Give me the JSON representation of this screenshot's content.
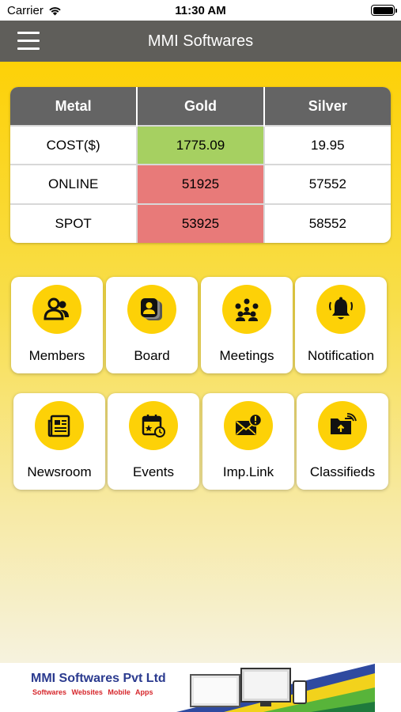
{
  "status_bar": {
    "carrier": "Carrier",
    "time": "11:30 AM"
  },
  "header": {
    "title": "MMI Softwares"
  },
  "rates_table": {
    "headers": [
      "Metal",
      "Gold",
      "Silver"
    ],
    "rows": [
      {
        "label": "COST($)",
        "gold": "1775.09",
        "silver": "19.95",
        "gold_status": "green"
      },
      {
        "label": "ONLINE",
        "gold": "51925",
        "silver": "57552",
        "gold_status": "red"
      },
      {
        "label": "SPOT",
        "gold": "53925",
        "silver": "58552",
        "gold_status": "red"
      }
    ]
  },
  "menu_tiles": [
    {
      "label": "Members",
      "icon": "members-icon"
    },
    {
      "label": "Board",
      "icon": "board-icon"
    },
    {
      "label": "Meetings",
      "icon": "meetings-icon"
    },
    {
      "label": "Notification",
      "icon": "bell-icon"
    },
    {
      "label": "Newsroom",
      "icon": "newspaper-icon"
    },
    {
      "label": "Events",
      "icon": "calendar-icon"
    },
    {
      "label": "Imp.Link",
      "icon": "mail-alert-icon"
    },
    {
      "label": "Classifieds",
      "icon": "folder-icon"
    }
  ],
  "ad": {
    "brand": "MMI Softwares Pvt Ltd",
    "tagline": "Softwares Websites Mobile Apps"
  },
  "colors": {
    "accent": "#fdd107",
    "navbar": "#5f5e5a",
    "table_header": "#646464",
    "up": "#a6d061",
    "down": "#e87a79"
  }
}
